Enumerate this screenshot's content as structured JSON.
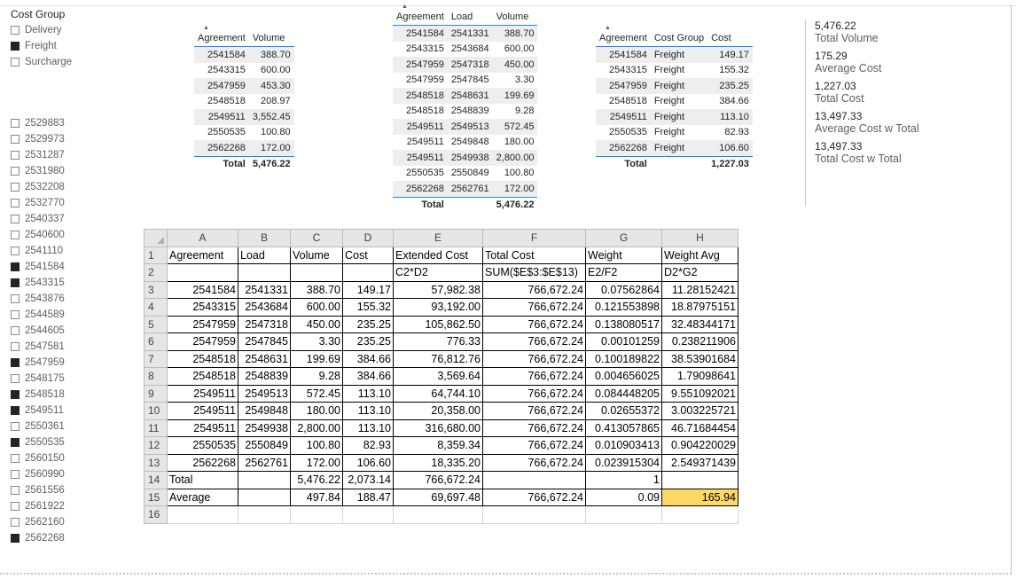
{
  "cost_group_slicer": {
    "title": "Cost Group",
    "items": [
      {
        "label": "Delivery",
        "checked": false
      },
      {
        "label": "Freight",
        "checked": true
      },
      {
        "label": "Surcharge",
        "checked": false
      }
    ]
  },
  "agreement_slicer": {
    "items": [
      {
        "label": "2529883",
        "checked": false
      },
      {
        "label": "2529973",
        "checked": false
      },
      {
        "label": "2531287",
        "checked": false
      },
      {
        "label": "2531980",
        "checked": false
      },
      {
        "label": "2532208",
        "checked": false
      },
      {
        "label": "2532770",
        "checked": false
      },
      {
        "label": "2540337",
        "checked": false
      },
      {
        "label": "2540600",
        "checked": false
      },
      {
        "label": "2541110",
        "checked": false
      },
      {
        "label": "2541584",
        "checked": true
      },
      {
        "label": "2543315",
        "checked": true
      },
      {
        "label": "2543876",
        "checked": false
      },
      {
        "label": "2544589",
        "checked": false
      },
      {
        "label": "2544605",
        "checked": false
      },
      {
        "label": "2547581",
        "checked": false
      },
      {
        "label": "2547959",
        "checked": true
      },
      {
        "label": "2548175",
        "checked": false
      },
      {
        "label": "2548518",
        "checked": true
      },
      {
        "label": "2549511",
        "checked": true
      },
      {
        "label": "2550361",
        "checked": false
      },
      {
        "label": "2550535",
        "checked": true
      },
      {
        "label": "2560150",
        "checked": false
      },
      {
        "label": "2560990",
        "checked": false
      },
      {
        "label": "2561556",
        "checked": false
      },
      {
        "label": "2561922",
        "checked": false
      },
      {
        "label": "2562160",
        "checked": false
      },
      {
        "label": "2562268",
        "checked": true
      }
    ]
  },
  "table1": {
    "headers": [
      "Agreement",
      "Volume"
    ],
    "rows": [
      [
        "2541584",
        "388.70"
      ],
      [
        "2543315",
        "600.00"
      ],
      [
        "2547959",
        "453.30"
      ],
      [
        "2548518",
        "208.97"
      ],
      [
        "2549511",
        "3,552.45"
      ],
      [
        "2550535",
        "100.80"
      ],
      [
        "2562268",
        "172.00"
      ]
    ],
    "total": [
      "Total",
      "5,476.22"
    ]
  },
  "table2": {
    "headers": [
      "Agreement",
      "Load",
      "Volume"
    ],
    "rows": [
      [
        "2541584",
        "2541331",
        "388.70"
      ],
      [
        "2543315",
        "2543684",
        "600.00"
      ],
      [
        "2547959",
        "2547318",
        "450.00"
      ],
      [
        "2547959",
        "2547845",
        "3.30"
      ],
      [
        "2548518",
        "2548631",
        "199.69"
      ],
      [
        "2548518",
        "2548839",
        "9.28"
      ],
      [
        "2549511",
        "2549513",
        "572.45"
      ],
      [
        "2549511",
        "2549848",
        "180.00"
      ],
      [
        "2549511",
        "2549938",
        "2,800.00"
      ],
      [
        "2550535",
        "2550849",
        "100.80"
      ],
      [
        "2562268",
        "2562761",
        "172.00"
      ]
    ],
    "total": [
      "Total",
      "",
      "5,476.22"
    ]
  },
  "table3": {
    "headers": [
      "Agreement",
      "Cost Group",
      "Cost"
    ],
    "rows": [
      [
        "2541584",
        "Freight",
        "149.17"
      ],
      [
        "2543315",
        "Freight",
        "155.32"
      ],
      [
        "2547959",
        "Freight",
        "235.25"
      ],
      [
        "2548518",
        "Freight",
        "384.66"
      ],
      [
        "2549511",
        "Freight",
        "113.10"
      ],
      [
        "2550535",
        "Freight",
        "82.93"
      ],
      [
        "2562268",
        "Freight",
        "106.60"
      ]
    ],
    "total": [
      "Total",
      "",
      "1,227.03"
    ]
  },
  "cards": [
    {
      "value": "5,476.22",
      "label": "Total Volume"
    },
    {
      "value": "175.29",
      "label": "Average Cost"
    },
    {
      "value": "1,227.03",
      "label": "Total Cost"
    },
    {
      "value": "13,497.33",
      "label": "Average Cost w Total"
    },
    {
      "value": "13,497.33",
      "label": "Total Cost w Total"
    }
  ],
  "excel": {
    "columns": [
      "A",
      "B",
      "C",
      "D",
      "E",
      "F",
      "G",
      "H"
    ],
    "rows": [
      {
        "num": "1",
        "cells": [
          "Agreement",
          "Load",
          "Volume",
          "Cost",
          "Extended Cost",
          "Total Cost",
          "Weight",
          "Weight Avg"
        ]
      },
      {
        "num": "2",
        "cells": [
          "",
          "",
          "",
          "",
          "C2*D2",
          "SUM($E$3:$E$13)",
          "E2/F2",
          "D2*G2"
        ]
      },
      {
        "num": "3",
        "cells": [
          "2541584",
          "2541331",
          "388.70",
          "149.17",
          "57,982.38",
          "766,672.24",
          "0.07562864",
          "11.28152421"
        ]
      },
      {
        "num": "4",
        "cells": [
          "2543315",
          "2543684",
          "600.00",
          "155.32",
          "93,192.00",
          "766,672.24",
          "0.121553898",
          "18.87975151"
        ]
      },
      {
        "num": "5",
        "cells": [
          "2547959",
          "2547318",
          "450.00",
          "235.25",
          "105,862.50",
          "766,672.24",
          "0.138080517",
          "32.48344171"
        ]
      },
      {
        "num": "6",
        "cells": [
          "2547959",
          "2547845",
          "3.30",
          "235.25",
          "776.33",
          "766,672.24",
          "0.00101259",
          "0.238211906"
        ]
      },
      {
        "num": "7",
        "cells": [
          "2548518",
          "2548631",
          "199.69",
          "384.66",
          "76,812.76",
          "766,672.24",
          "0.100189822",
          "38.53901684"
        ]
      },
      {
        "num": "8",
        "cells": [
          "2548518",
          "2548839",
          "9.28",
          "384.66",
          "3,569.64",
          "766,672.24",
          "0.004656025",
          "1.79098641"
        ]
      },
      {
        "num": "9",
        "cells": [
          "2549511",
          "2549513",
          "572.45",
          "113.10",
          "64,744.10",
          "766,672.24",
          "0.084448205",
          "9.551092021"
        ]
      },
      {
        "num": "10",
        "cells": [
          "2549511",
          "2549848",
          "180.00",
          "113.10",
          "20,358.00",
          "766,672.24",
          "0.02655372",
          "3.003225721"
        ]
      },
      {
        "num": "11",
        "cells": [
          "2549511",
          "2549938",
          "2,800.00",
          "113.10",
          "316,680.00",
          "766,672.24",
          "0.413057865",
          "46.71684454"
        ]
      },
      {
        "num": "12",
        "cells": [
          "2550535",
          "2550849",
          "100.80",
          "82.93",
          "8,359.34",
          "766,672.24",
          "0.010903413",
          "0.904220029"
        ]
      },
      {
        "num": "13",
        "cells": [
          "2562268",
          "2562761",
          "172.00",
          "106.60",
          "18,335.20",
          "766,672.24",
          "0.023915304",
          "2.549371439"
        ]
      },
      {
        "num": "14",
        "cells": [
          "Total",
          "",
          "5,476.22",
          "2,073.14",
          "766,672.24",
          "",
          "1",
          ""
        ]
      },
      {
        "num": "15",
        "cells": [
          "Average",
          "",
          "497.84",
          "188.47",
          "69,697.48",
          "766,672.24",
          "0.09",
          "165.94"
        ]
      },
      {
        "num": "16",
        "cells": [
          "",
          "",
          "",
          "",
          "",
          "",
          "",
          ""
        ]
      }
    ]
  }
}
